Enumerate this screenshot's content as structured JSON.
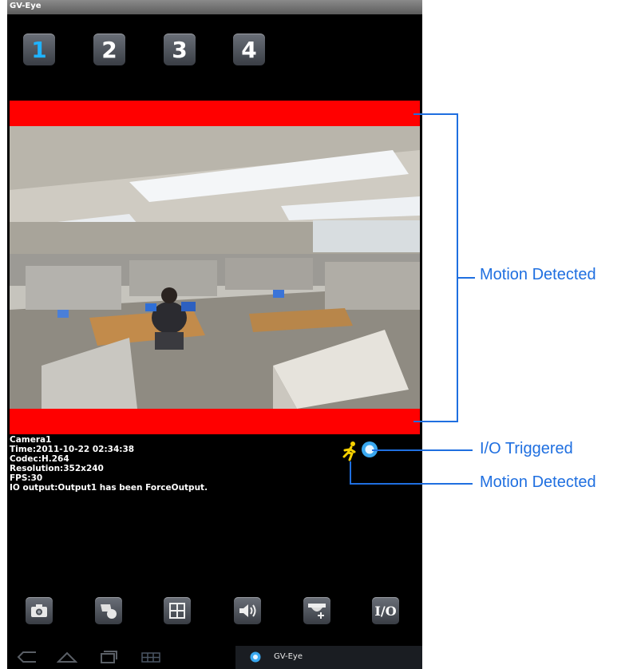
{
  "window": {
    "title": "GV-Eye"
  },
  "channels": [
    {
      "label": "1",
      "active": true
    },
    {
      "label": "2",
      "active": false
    },
    {
      "label": "3",
      "active": false
    },
    {
      "label": "4",
      "active": false
    }
  ],
  "camera_info": {
    "name": "Camera1",
    "time": "Time:2011-10-22  02:34:38",
    "codec": "Codec:H.264",
    "resolution": "Resolution:352x240",
    "fps": "FPS:30",
    "io_output": "IO output:Output1 has been ForceOutput."
  },
  "status_icons": [
    {
      "icon": "motion-running-man-icon",
      "color": "#f5d000"
    },
    {
      "icon": "io-trigger-circle-icon",
      "color": "#39a8f0"
    }
  ],
  "toolbar": [
    {
      "icon": "camera-snapshot-icon"
    },
    {
      "icon": "ptz-camera-icon"
    },
    {
      "icon": "grid-layout-icon"
    },
    {
      "icon": "speaker-icon"
    },
    {
      "icon": "dome-camera-move-icon"
    },
    {
      "icon": "io-control-icon",
      "label": "I/O"
    }
  ],
  "system_nav": [
    {
      "icon": "back-icon"
    },
    {
      "icon": "home-icon"
    },
    {
      "icon": "recent-apps-icon"
    },
    {
      "icon": "screenshot-grid-icon"
    }
  ],
  "notification": {
    "label": "GV-Eye"
  },
  "annotations": {
    "motion_main": "Motion Detected",
    "io_triggered": "I/O Triggered",
    "motion_icon": "Motion Detected"
  },
  "colors": {
    "motion_bar": "#ff0000",
    "annotation": "#1f6fe0",
    "active_channel": "#1fb3ff"
  }
}
